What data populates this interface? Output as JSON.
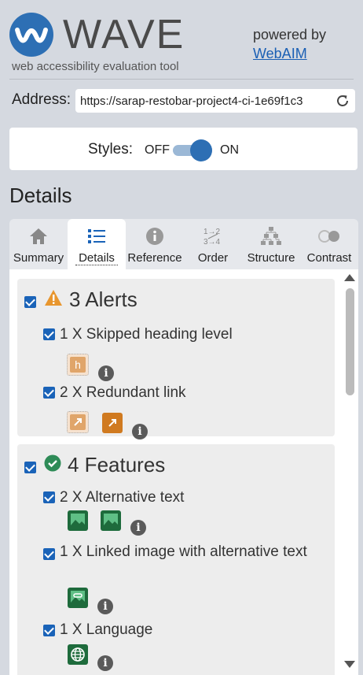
{
  "header": {
    "logo_text": "WAVE",
    "tagline": "web accessibility evaluation tool",
    "powered_by": "powered by",
    "webaim_link": "WebAIM"
  },
  "address": {
    "label": "Address:",
    "value": "https://sarap-restobar-project4-ci-1e69f1c3"
  },
  "styles": {
    "label": "Styles:",
    "off": "OFF",
    "on": "ON",
    "state": "on"
  },
  "details_heading": "Details",
  "tabs": [
    {
      "label": "Summary",
      "icon": "home-icon"
    },
    {
      "label": "Details",
      "icon": "list-icon",
      "active": true
    },
    {
      "label": "Reference",
      "icon": "info-icon"
    },
    {
      "label": "Order",
      "icon": "order-icon"
    },
    {
      "label": "Structure",
      "icon": "structure-icon"
    },
    {
      "label": "Contrast",
      "icon": "contrast-icon"
    }
  ],
  "alerts": {
    "title": "3 Alerts",
    "items": [
      {
        "label": "1 X Skipped heading level"
      },
      {
        "label": "2 X Redundant link"
      }
    ]
  },
  "features": {
    "title": "4 Features",
    "items": [
      {
        "label": "2 X Alternative text"
      },
      {
        "label": "1 X Linked image with alternative text"
      },
      {
        "label": "1 X Language"
      }
    ]
  },
  "colors": {
    "brand_blue": "#2d6fb4",
    "alert_orange": "#e8962e",
    "feature_green": "#2e8b57"
  }
}
